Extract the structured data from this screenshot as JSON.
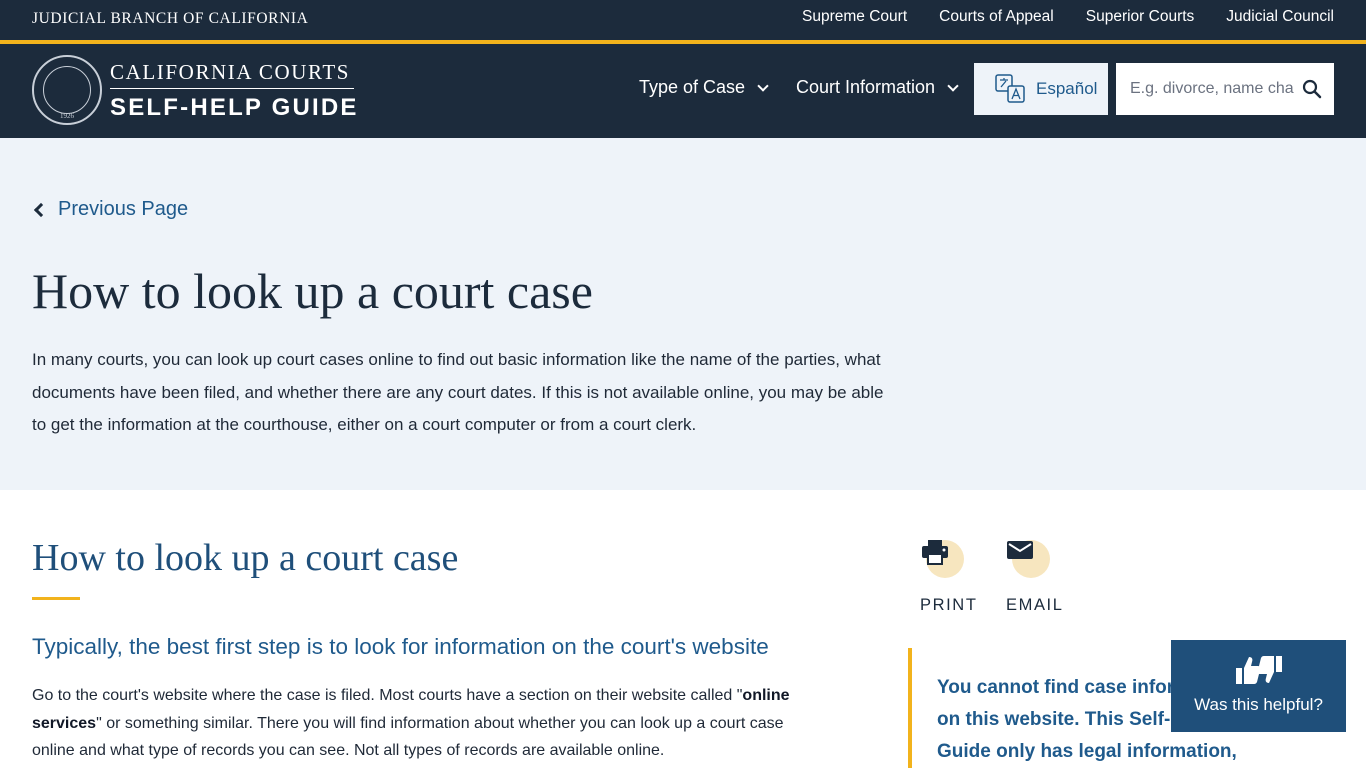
{
  "topbar": {
    "branch": "JUDICIAL BRANCH OF CALIFORNIA",
    "links": [
      "Supreme Court",
      "Courts of Appeal",
      "Superior Courts",
      "Judicial Council"
    ]
  },
  "header": {
    "seal_year": "1926",
    "brand_line1": "CALIFORNIA COURTS",
    "brand_line2": "SELF-HELP GUIDE",
    "nav": [
      "Type of Case",
      "Court Information"
    ],
    "language_button": "Español",
    "search_placeholder": "E.g. divorce, name change"
  },
  "hero": {
    "back_link": "Previous Page",
    "title": "How to look up a court case",
    "intro": "In many courts, you can look up court cases online to find out basic information like the name of the parties, what documents have been filed, and whether there are any court dates. If this is not available online, you may be able to get the information at the courthouse, either on a court computer or from a court clerk."
  },
  "content": {
    "heading": "How to look up a court case",
    "subheading": "Typically, the best first step is to look for information on the court's website",
    "para_before": "Go to the court's website where the case is filed. Most courts have a section on their website called \"",
    "para_bold": "online services",
    "para_after": "\" or something similar. There you will find information about whether you can look up a court case online and what type of records you can see. Not all types of records are available online."
  },
  "tools": {
    "print": "PRINT",
    "email": "EMAIL"
  },
  "callout": {
    "text": "You cannot find case information on this website. This Self-Help Guide only has legal information,"
  },
  "feedback": {
    "label": "Was this helpful?"
  },
  "colors": {
    "navy": "#1c2b3c",
    "gold": "#f2b31c",
    "link_blue": "#1f5a8c",
    "hero_bg": "#eef3f9"
  }
}
